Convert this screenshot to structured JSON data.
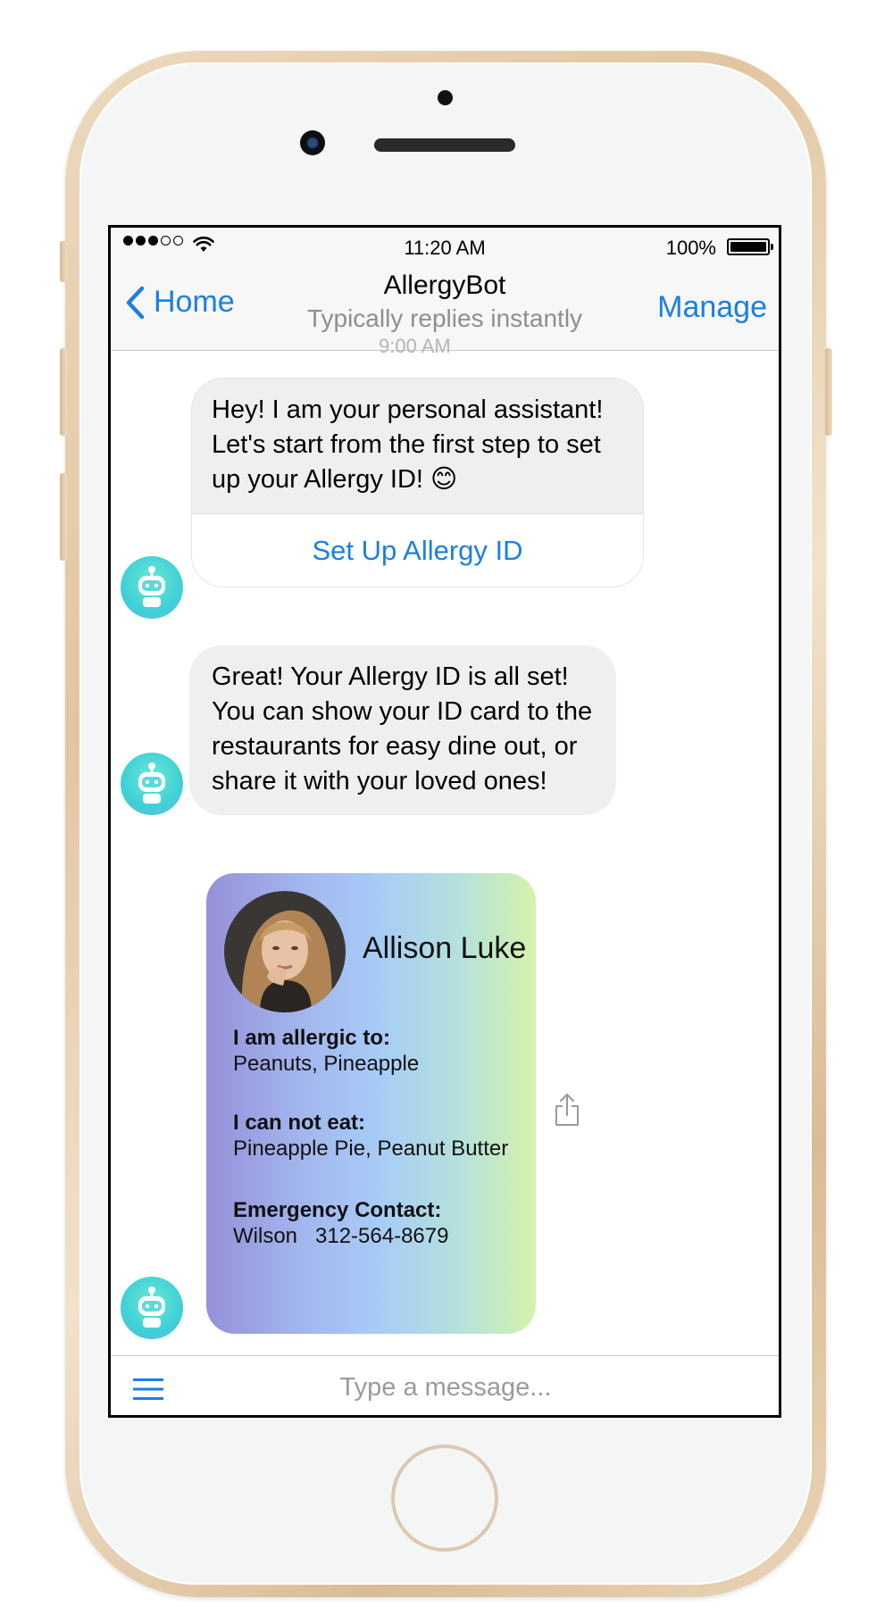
{
  "status_bar": {
    "time": "11:20 AM",
    "battery_percent": "100%",
    "signal_bars_filled": 3,
    "signal_bars_total": 5
  },
  "nav": {
    "back_label": "Home",
    "title": "AllergyBot",
    "subtitle": "Typically replies instantly",
    "manage_label": "Manage"
  },
  "chat": {
    "timestamp": "9:00 AM",
    "messages": [
      {
        "text": "Hey! I am your personal assistant! Let's start from the first step to set up your Allergy ID! 😊",
        "button_label": "Set Up Allergy ID"
      },
      {
        "text": "Great! Your Allergy ID is all set! You can show your ID card to the restaurants for easy dine out, or share it with your loved ones!"
      }
    ],
    "id_card": {
      "name": "Allison Luke",
      "allergic_label": "I am allergic to:",
      "allergic_value": "Peanuts, Pineapple",
      "cannot_eat_label": "I can not eat:",
      "cannot_eat_value": "Pineapple Pie, Peanut Butter",
      "emergency_label": "Emergency Contact:",
      "emergency_value": "Wilson   312-564-8679"
    }
  },
  "composer": {
    "placeholder": "Type a message..."
  },
  "colors": {
    "accent_blue": "#1a7fe5",
    "bubble_gray": "#efefef",
    "frame_gold": "#e2c6a1"
  },
  "icons": [
    "back-chevron-icon",
    "wifi-icon",
    "battery-icon",
    "bot-avatar-icon",
    "share-icon",
    "menu-icon"
  ]
}
